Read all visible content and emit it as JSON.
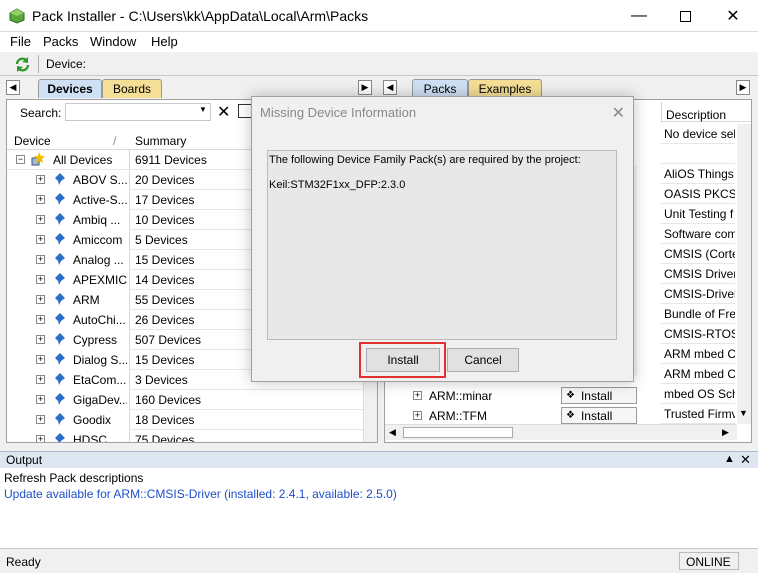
{
  "window": {
    "title": "Pack Installer - C:\\Users\\kk\\AppData\\Local\\Arm\\Packs"
  },
  "menu": [
    "File",
    "Packs",
    "Window",
    "Help"
  ],
  "toolbar": {
    "device_label": "Device:"
  },
  "left_tabs": {
    "devices": "Devices",
    "boards": "Boards"
  },
  "right_tabs": {
    "packs": "Packs",
    "examples": "Examples"
  },
  "search": {
    "label": "Search:",
    "value": ""
  },
  "device_table": {
    "headers": {
      "device": "Device",
      "summary": "Summary"
    },
    "root": {
      "name": "All Devices",
      "summary": "6911 Devices"
    },
    "rows": [
      {
        "name": "ABOV S...",
        "summary": "20 Devices"
      },
      {
        "name": "Active-S...",
        "summary": "17 Devices"
      },
      {
        "name": "Ambiq ...",
        "summary": "10 Devices"
      },
      {
        "name": "Amiccom",
        "summary": "5 Devices"
      },
      {
        "name": "Analog ...",
        "summary": "15 Devices"
      },
      {
        "name": "APEXMIC",
        "summary": "14 Devices"
      },
      {
        "name": "ARM",
        "summary": "55 Devices"
      },
      {
        "name": "AutoChi...",
        "summary": "26 Devices"
      },
      {
        "name": "Cypress",
        "summary": "507 Devices"
      },
      {
        "name": "Dialog S...",
        "summary": "15 Devices"
      },
      {
        "name": "EtaCom...",
        "summary": "3 Devices"
      },
      {
        "name": "GigaDev...",
        "summary": "160 Devices"
      },
      {
        "name": "Goodix",
        "summary": "18 Devices"
      },
      {
        "name": "HDSC",
        "summary": "75 Devices"
      }
    ]
  },
  "packs_table": {
    "description_header": "Description",
    "descriptions": [
      "No device sel",
      "",
      "AliOS Things",
      "OASIS PKCS #",
      "Unit Testing f",
      "Software com",
      "CMSIS (Corte",
      "CMSIS Driver",
      "CMSIS-Driver",
      "Bundle of Fre",
      "CMSIS-RTOS",
      "ARM mbed C",
      "ARM mbed C",
      "mbed OS Sch",
      "Trusted Firmv"
    ],
    "visible_rows": [
      {
        "name": "ARM::minar",
        "action": "Install"
      },
      {
        "name": "ARM::TFM",
        "action": "Install"
      }
    ],
    "partial_action": "te"
  },
  "dialog": {
    "title": "Missing Device Information",
    "message": "The following Device Family Pack(s) are required by the project:",
    "pack": "Keil:STM32F1xx_DFP:2.3.0",
    "install_button": "Install",
    "cancel_button": "Cancel"
  },
  "output": {
    "title": "Output",
    "lines": [
      {
        "text": "Refresh Pack descriptions",
        "color": "#000000"
      },
      {
        "text": "Update available for ARM::CMSIS-Driver (installed: 2.4.1,  available: 2.5.0)",
        "color": "#1e4fc8"
      }
    ]
  },
  "status": {
    "left": "Ready",
    "right": "ONLINE"
  },
  "colors": {
    "highlight": "#e03030",
    "link": "#1e4fc8",
    "tab_active": "#cfe0f4",
    "tab_alt": "#f5df96"
  }
}
